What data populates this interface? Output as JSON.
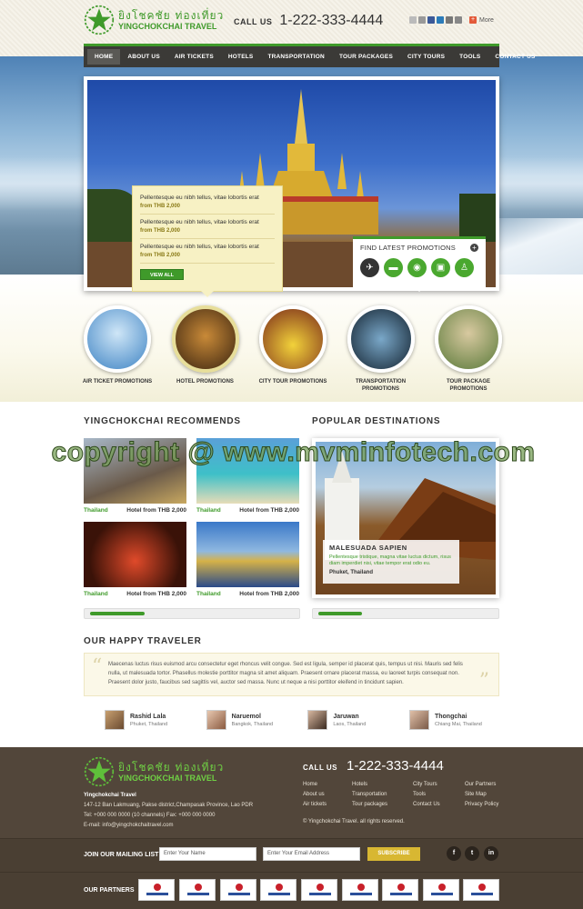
{
  "header": {
    "logo_script": "ยิงโชคชัย ท่องเที่ยว",
    "logo_name": "YINGCHOKCHAI TRAVEL",
    "call_label": "CALL US",
    "call_number": "1-222-333-4444",
    "more_label": "More"
  },
  "nav": {
    "items": [
      "HOME",
      "ABOUT US",
      "AIR TICKETS",
      "HOTELS",
      "TRANSPORTATION",
      "TOUR PACKAGES",
      "CITY TOURS",
      "TOOLS",
      "CONTACT US"
    ]
  },
  "promos": {
    "items": [
      {
        "title": "Pellentesque eu nibh tellus, vitae lobortis erat",
        "price": "from THB 2,000"
      },
      {
        "title": "Pellentesque eu nibh tellus, vitae lobortis erat",
        "price": "from THB 2,000"
      },
      {
        "title": "Pellentesque eu nibh tellus, vitae lobortis erat",
        "price": "from THB 2,000"
      }
    ],
    "view_all": "VIEW ALL"
  },
  "latest": {
    "title": "FIND LATEST PROMOTIONS",
    "icons": [
      "plane-icon",
      "bed-icon",
      "camera-icon",
      "car-icon",
      "hiker-icon"
    ]
  },
  "categories": [
    {
      "label": "AIR TICKET PROMOTIONS"
    },
    {
      "label": "HOTEL PROMOTIONS"
    },
    {
      "label": "CITY TOUR PROMOTIONS"
    },
    {
      "label": "TRANSPORTATION PROMOTIONS"
    },
    {
      "label": "TOUR PACKAGE PROMOTIONS"
    }
  ],
  "recommends": {
    "title": "YINGCHOKCHAI RECOMMENDS",
    "items": [
      {
        "country": "Thailand",
        "price": "Hotel from THB 2,000"
      },
      {
        "country": "Thailand",
        "price": "Hotel from THB 2,000"
      },
      {
        "country": "Thailand",
        "price": "Hotel from THB 2,000"
      },
      {
        "country": "Thailand",
        "price": "Hotel from THB 2,000"
      }
    ]
  },
  "popular": {
    "title": "POPULAR DESTINATIONS",
    "name": "MALESUADA SAPIEN",
    "desc": "Pellentesque tristique, magna vitae luctus dictum, risus diam imperdiet nisi, vitae tempor erat odio eu.",
    "location": "Phuket, Thailand"
  },
  "happy": {
    "title": "OUR HAPPY TRAVELER",
    "quote": "Maecenas luctus risus euismod arcu consectetur eget rhoncus velit congue. Sed est ligula, semper id placerat quis, tempus ut nisi. Mauris sed felis nulla, ut malesuada tortor. Phasellus molestie porttitor magna sit amet aliquam. Praesent ornare placerat massa, eu laoreet turpis consequat non. Praesent dolor justo, faucibus sed sagittis vel, auctor sed massa. Nunc ut neque a nisi porttitor eleifend in tincidunt sapien.",
    "travelers": [
      {
        "name": "Rashid Lala",
        "location": "Phuket, Thailand"
      },
      {
        "name": "Naruemol",
        "location": "Bangkok, Thailand"
      },
      {
        "name": "Jaruwan",
        "location": "Laos, Thailand"
      },
      {
        "name": "Thongchai",
        "location": "Chiang Mai, Thailand"
      }
    ]
  },
  "footer": {
    "logo_script": "ยิงโชคชัย ท่องเที่ยว",
    "logo_name": "YINGCHOKCHAI TRAVEL",
    "company": "Yingchokchai Travel",
    "address": "147-12 Ban Lakmuang, Pakse district,Champasak Province, Lao PDR",
    "tel": "Tel: +000 000 0000 (10 channels)  Fax: +000 000 0000",
    "email": "E-mail: info@yingchokchaitravel.com",
    "call_label": "CALL US",
    "call_number": "1-222-333-4444",
    "links": [
      [
        "Home",
        "About us",
        "Air tickets"
      ],
      [
        "Hotels",
        "Transportation",
        "Tour packages"
      ],
      [
        "City Tours",
        "Tools",
        "Contact Us"
      ],
      [
        "Our Partners",
        "Site Map",
        "Privacy Policy"
      ]
    ],
    "copyright": "© Yingchokchai Travel. all rights reserved.",
    "mailing_label": "JOIN OUR MAILING LIST",
    "name_placeholder": "Enter Your Name",
    "email_placeholder": "Enter Your Email Address",
    "subscribe": "SUBSCRIBE",
    "partners_label": "OUR PARTNERS"
  },
  "watermark": "copyright @ www.mvminfotech.com",
  "colors": {
    "accent": "#3f9a2a",
    "nav": "#3b3a37",
    "footer": "#4a3f33",
    "subscribe": "#d8b732"
  }
}
